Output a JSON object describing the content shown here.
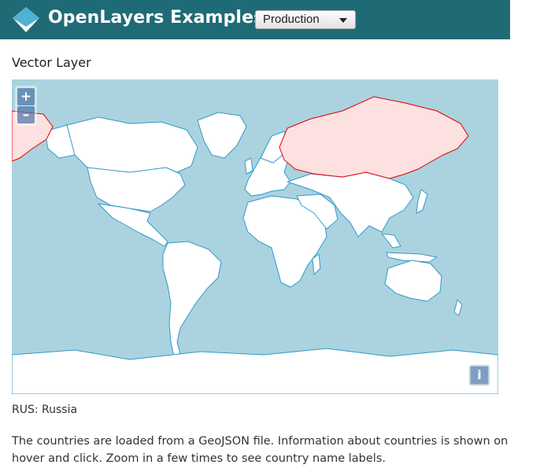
{
  "header": {
    "logo_icon": "openlayers-logo-icon",
    "title": "OpenLayers Examples",
    "version_select": {
      "selected": "Production"
    },
    "background": "#1f6b75"
  },
  "page": {
    "title": "Vector Layer"
  },
  "map": {
    "controls": {
      "zoom_in_label": "+",
      "zoom_out_label": "–",
      "attribution_label": "i"
    },
    "ocean_color": "#aad3df",
    "land_color": "#ffffff",
    "border_color": "#3399cc",
    "highlight_fill": "#fde0e0",
    "highlight_stroke": "#e00000",
    "highlighted_country": "Russia"
  },
  "info_text": "RUS: Russia",
  "description": "The countries are loaded from a GeoJSON file. Information about countries is shown on hover and click. Zoom in a few times to see country name labels."
}
